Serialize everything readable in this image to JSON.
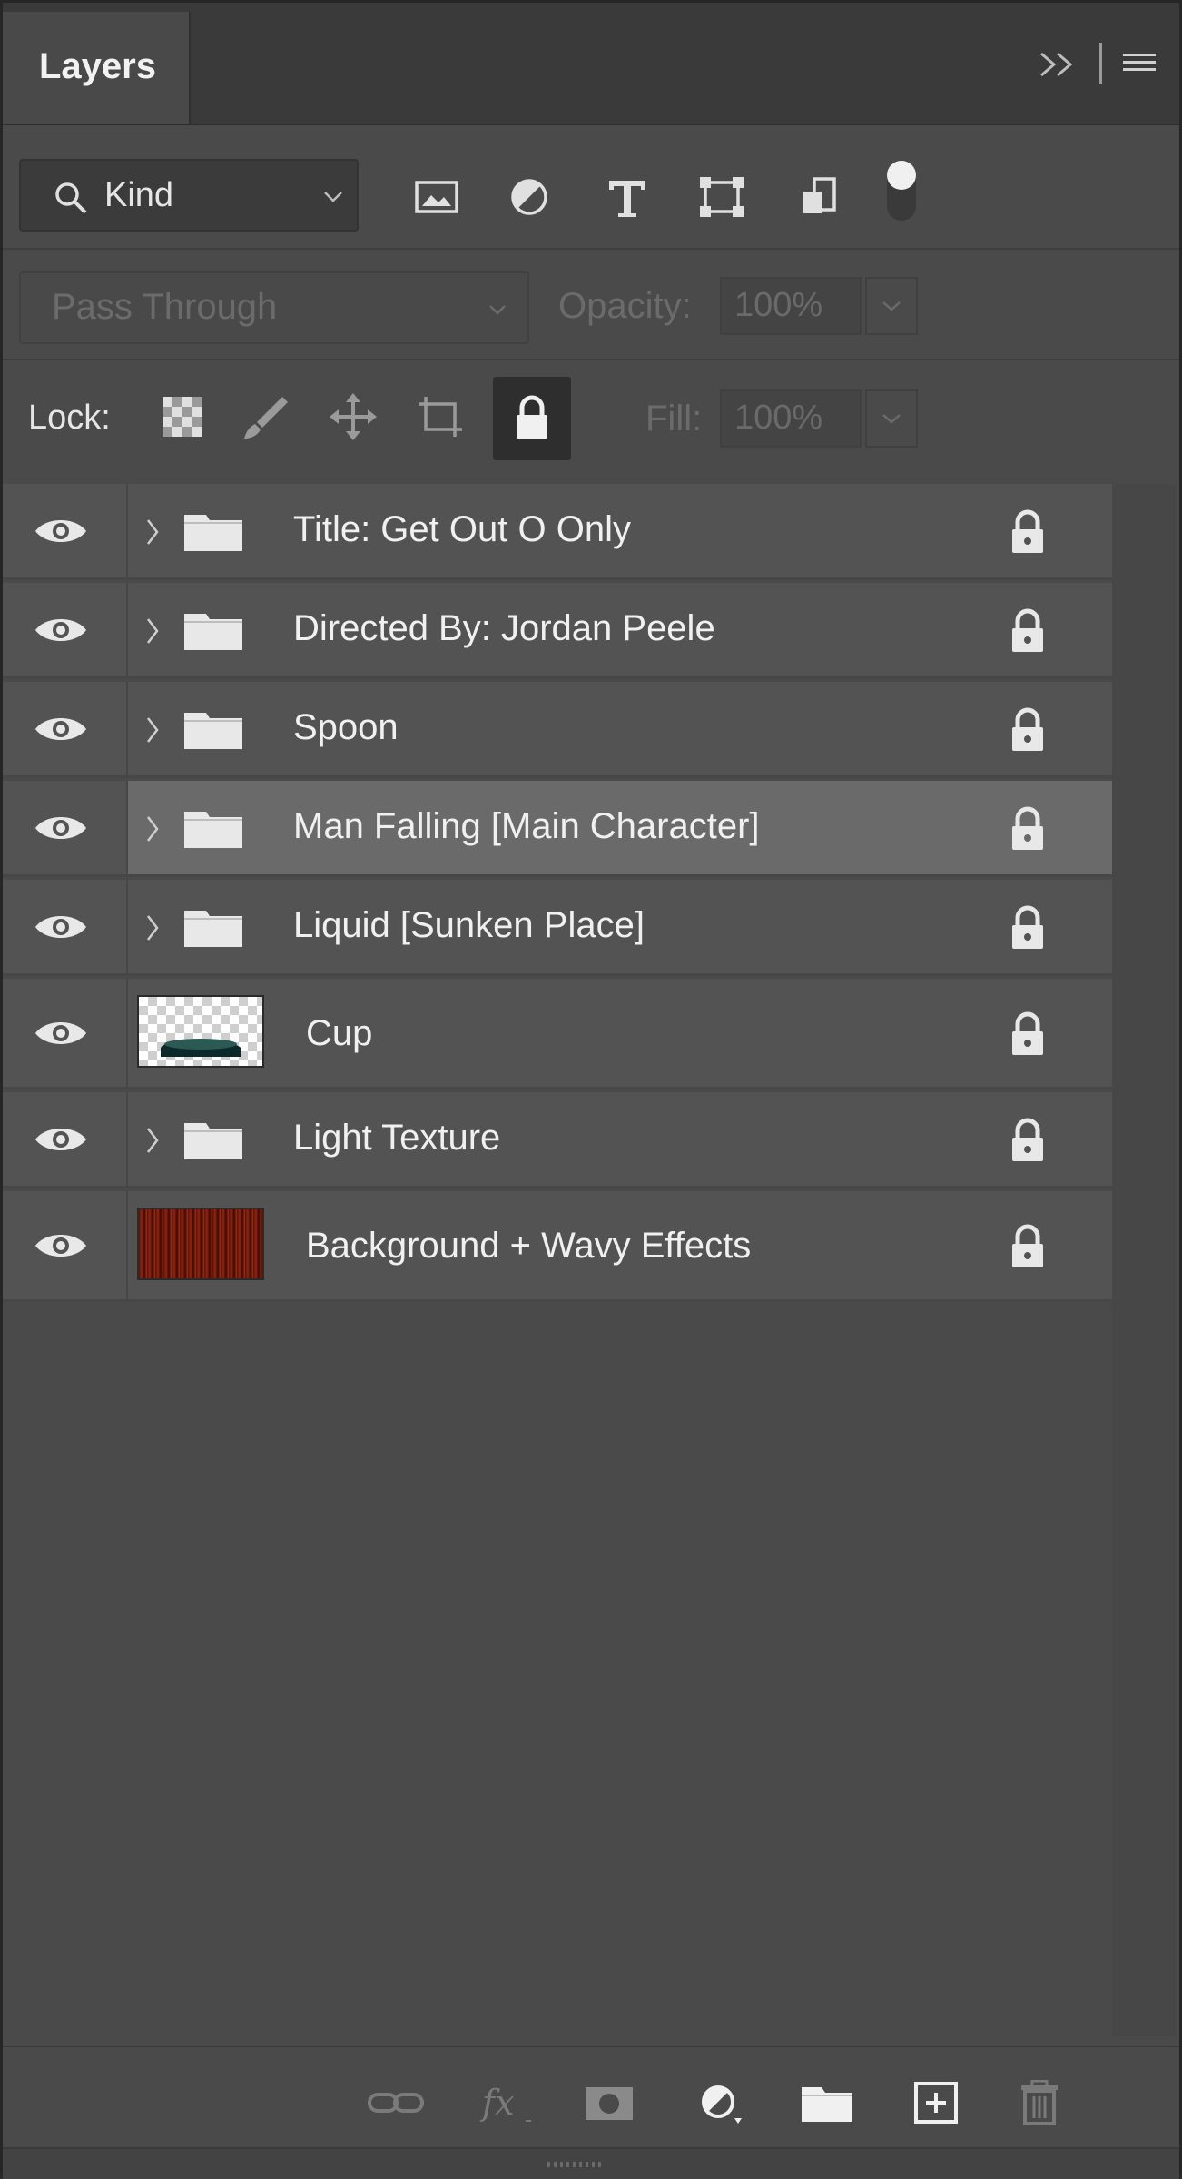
{
  "panel": {
    "title": "Layers"
  },
  "filter": {
    "kind_label": "Kind"
  },
  "blend": {
    "mode": "Pass Through",
    "opacity_label": "Opacity:",
    "opacity_value": "100%",
    "fill_label": "Fill:",
    "fill_value": "100%"
  },
  "lock": {
    "label": "Lock:"
  },
  "layers": [
    {
      "name": "Title: Get Out O Only",
      "type": "group",
      "visible": true,
      "locked": true,
      "selected": false
    },
    {
      "name": "Directed By: Jordan Peele",
      "type": "group",
      "visible": true,
      "locked": true,
      "selected": false
    },
    {
      "name": "Spoon",
      "type": "group",
      "visible": true,
      "locked": true,
      "selected": false
    },
    {
      "name": "Man Falling [Main Character]",
      "type": "group",
      "visible": true,
      "locked": true,
      "selected": true
    },
    {
      "name": "Liquid [Sunken Place]",
      "type": "group",
      "visible": true,
      "locked": true,
      "selected": false
    },
    {
      "name": "Cup",
      "type": "pixel",
      "visible": true,
      "locked": true,
      "selected": false
    },
    {
      "name": "Light Texture",
      "type": "group",
      "visible": true,
      "locked": true,
      "selected": false
    },
    {
      "name": "Background + Wavy Effects",
      "type": "pixel",
      "visible": true,
      "locked": true,
      "selected": false
    }
  ],
  "colors": {
    "panel_bg": "#4a4a4a",
    "row_bg": "#535353",
    "selected_row_bg": "#6a6a6a",
    "text": "#f0f0f0"
  },
  "icons": {
    "filter": [
      "image-filter-icon",
      "adjustment-filter-icon",
      "type-filter-icon",
      "shape-filter-icon",
      "smart-object-filter-icon",
      "filter-toggle-icon"
    ],
    "lock": [
      "lock-transparent-pixels-icon",
      "lock-image-pixels-icon",
      "lock-position-icon",
      "lock-artboard-icon",
      "lock-all-icon"
    ],
    "bottom": [
      "link-layers-icon",
      "fx-icon",
      "add-mask-icon",
      "adjustment-layer-icon",
      "new-group-icon",
      "new-layer-icon",
      "delete-icon"
    ]
  }
}
